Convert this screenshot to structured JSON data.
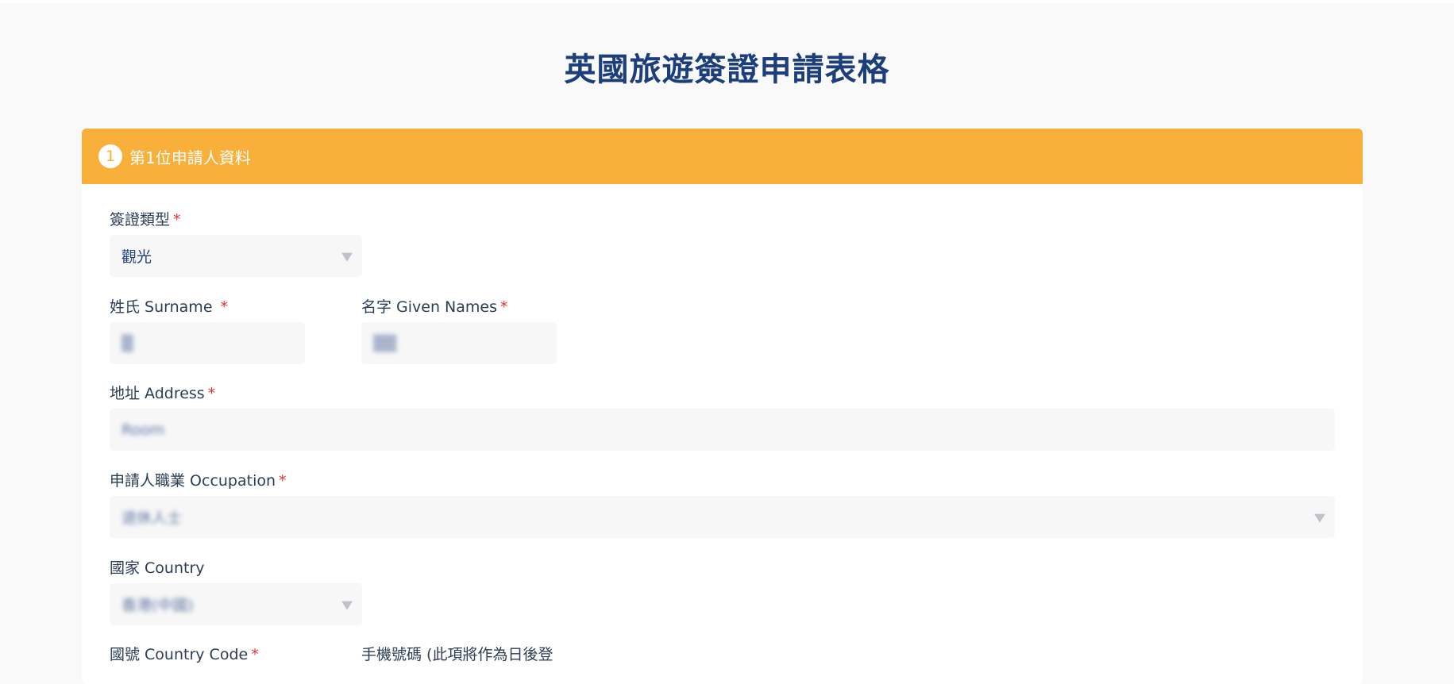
{
  "page": {
    "title": "英國旅遊簽證申請表格"
  },
  "section": {
    "step_number": "1",
    "title": "第1位申請人資料"
  },
  "fields": {
    "visa_type": {
      "label": "簽證類型",
      "required_mark": "*",
      "value": "觀光",
      "icon": "chevron-down-icon"
    },
    "surname": {
      "label": "姓氏 Surname ",
      "required_mark": "*",
      "value": "▒"
    },
    "given_names": {
      "label": "名字 Given Names",
      "required_mark": "*",
      "value": "▒▒"
    },
    "address": {
      "label": "地址 Address",
      "required_mark": "*",
      "value": "Room"
    },
    "occupation": {
      "label": "申請人職業 Occupation",
      "required_mark": "*",
      "value": "退休人士",
      "icon": "chevron-down-icon"
    },
    "country": {
      "label": "國家 Country",
      "value": "香港(中國)",
      "icon": "chevron-down-icon"
    },
    "country_code": {
      "label": "國號 Country Code",
      "required_mark": "*"
    },
    "mobile": {
      "label": "手機號碼 (此項將作為日後登"
    }
  },
  "colors": {
    "accent": "#f8b03b",
    "title": "#1c3f7c",
    "required": "#e03535",
    "input_bg": "#f7f7f8"
  }
}
